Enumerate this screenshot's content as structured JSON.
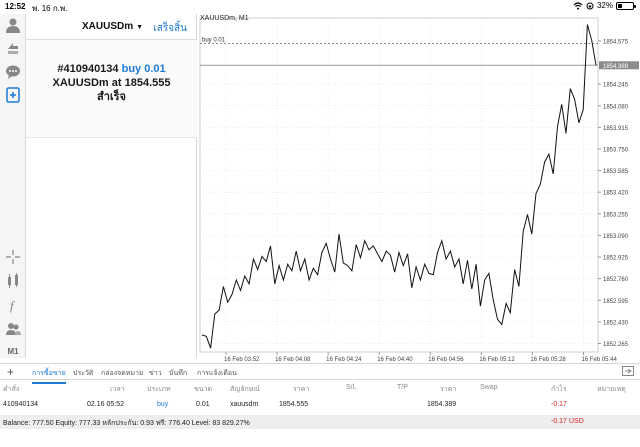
{
  "status_bar": {
    "time": "12:52",
    "date": "พ. 16 ก.พ.",
    "battery": "32%",
    "battery_level": 0.32
  },
  "panel": {
    "symbol": "XAUUSDm",
    "done_label": "เสร็จสิ้น",
    "result": {
      "ticket": "#410940134",
      "action": "buy 0.01",
      "symbol_at": "XAUUSDm at",
      "price": "1854.555",
      "status": "สำเร็จ"
    }
  },
  "toolbar_icons": [
    "profile-icon",
    "trade-icon",
    "chat-icon",
    "new-order-icon",
    "crosshair-icon",
    "indicators-icon",
    "function-icon",
    "objects-icon",
    "timeframe-icon"
  ],
  "toolbar_timeframe": "M1",
  "chart_data": {
    "type": "line",
    "title": "XAUUSDm, M1",
    "order_line_label": "buy 0.01",
    "order_price": 1854.555,
    "bid_price": 1854.389,
    "bid_label": "1854.389",
    "ylim": [
      1852.2,
      1854.75
    ],
    "y_ticks": [
      "1854.575",
      "1854.245",
      "1854.080",
      "1853.915",
      "1853.750",
      "1853.585",
      "1853.420",
      "1853.255",
      "1853.090",
      "1852.925",
      "1852.760",
      "1852.595",
      "1852.430",
      "1852.265"
    ],
    "x_ticks": [
      "16 Feb 03:52",
      "16 Feb 04:08",
      "16 Feb 04:24",
      "16 Feb 04:40",
      "16 Feb 04:56",
      "16 Feb 05:12",
      "16 Feb 05:28",
      "16 Feb 05:44"
    ],
    "values": [
      1852.33,
      1852.32,
      1852.23,
      1852.49,
      1852.52,
      1852.7,
      1852.58,
      1852.64,
      1852.75,
      1852.67,
      1852.78,
      1852.72,
      1852.91,
      1852.83,
      1852.93,
      1852.89,
      1853.01,
      1852.72,
      1852.86,
      1852.75,
      1852.87,
      1852.82,
      1852.97,
      1852.82,
      1852.91,
      1852.75,
      1852.84,
      1852.79,
      1852.96,
      1853.03,
      1852.91,
      1852.81,
      1853.1,
      1852.88,
      1852.86,
      1852.82,
      1853.02,
      1852.92,
      1853.05,
      1852.98,
      1853.01,
      1852.95,
      1852.89,
      1852.97,
      1852.94,
      1852.81,
      1852.96,
      1852.86,
      1852.95,
      1852.69,
      1852.85,
      1852.75,
      1852.87,
      1852.8,
      1852.79,
      1852.96,
      1853.05,
      1852.91,
      1852.97,
      1852.85,
      1852.91,
      1852.72,
      1852.9,
      1852.68,
      1852.87,
      1852.55,
      1852.75,
      1852.8,
      1852.6,
      1852.45,
      1852.41,
      1852.57,
      1852.5,
      1852.83,
      1852.7,
      1853.12,
      1853.25,
      1853.1,
      1853.41,
      1853.48,
      1853.65,
      1853.71,
      1853.56,
      1853.92,
      1854.09,
      1853.87,
      1854.21,
      1854.13,
      1853.95,
      1854.05,
      1854.7,
      1854.58,
      1854.39
    ]
  },
  "bottom_tabs": [
    "การซื้อขาย",
    "ประวัติ",
    "กล่องจดหมาย",
    "ข่าว",
    "บันทึก",
    "การแจ้งเตือน"
  ],
  "table": {
    "headers": [
      "คำสั่ง",
      "เวลา",
      "ประเภท",
      "ขนาด",
      "สัญลักษณ์",
      "ราคา",
      "S/L",
      "T/P",
      "ราคา",
      "Swap",
      "กำไร",
      "หมายเหตุ"
    ],
    "row": {
      "ticket": "410940134",
      "time": "02.16 05:52",
      "type": "buy",
      "size": "0.01",
      "symbol": "xauusdm",
      "open_price": "1854.555",
      "current_price": "1854.389",
      "profit": "-0.17"
    },
    "summary": "Balance: 777.50 Equity: 777.33 หลักประกัน: 0.93 ฟรี: 776.40 Level: 83 829.27%",
    "summary_pl": "-0.17",
    "summary_currency": "USD"
  },
  "colors": {
    "accent": "#1e7bd6",
    "loss": "#e02020",
    "price_line": "#111111"
  }
}
